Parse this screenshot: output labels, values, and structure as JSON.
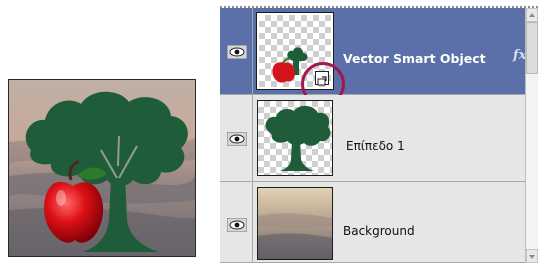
{
  "layers_panel": {
    "layers": [
      {
        "name": "Vector Smart Object",
        "selected": true,
        "has_fx": true,
        "visible": true,
        "thumb": "tree-apple-on-transparent"
      },
      {
        "name": "Επίπεδο 1",
        "selected": false,
        "has_fx": false,
        "visible": true,
        "thumb": "tree-on-transparent"
      },
      {
        "name": "Background",
        "selected": false,
        "has_fx": false,
        "visible": true,
        "thumb": "landscape-photo"
      }
    ],
    "fx_label": "fx",
    "icons": {
      "visibility": "eye-icon",
      "smart_object": "smart-object-badge-icon",
      "effects": "fx-icon",
      "scroll_up": "arrow-up-icon",
      "scroll_down": "arrow-down-icon"
    }
  },
  "colors": {
    "selected_row": "#5b6fa8",
    "panel_bg": "#e6e6e6",
    "tree_green": "#1f5c3a",
    "apple_red": "#d3141a",
    "highlight_ring": "#a11550"
  }
}
